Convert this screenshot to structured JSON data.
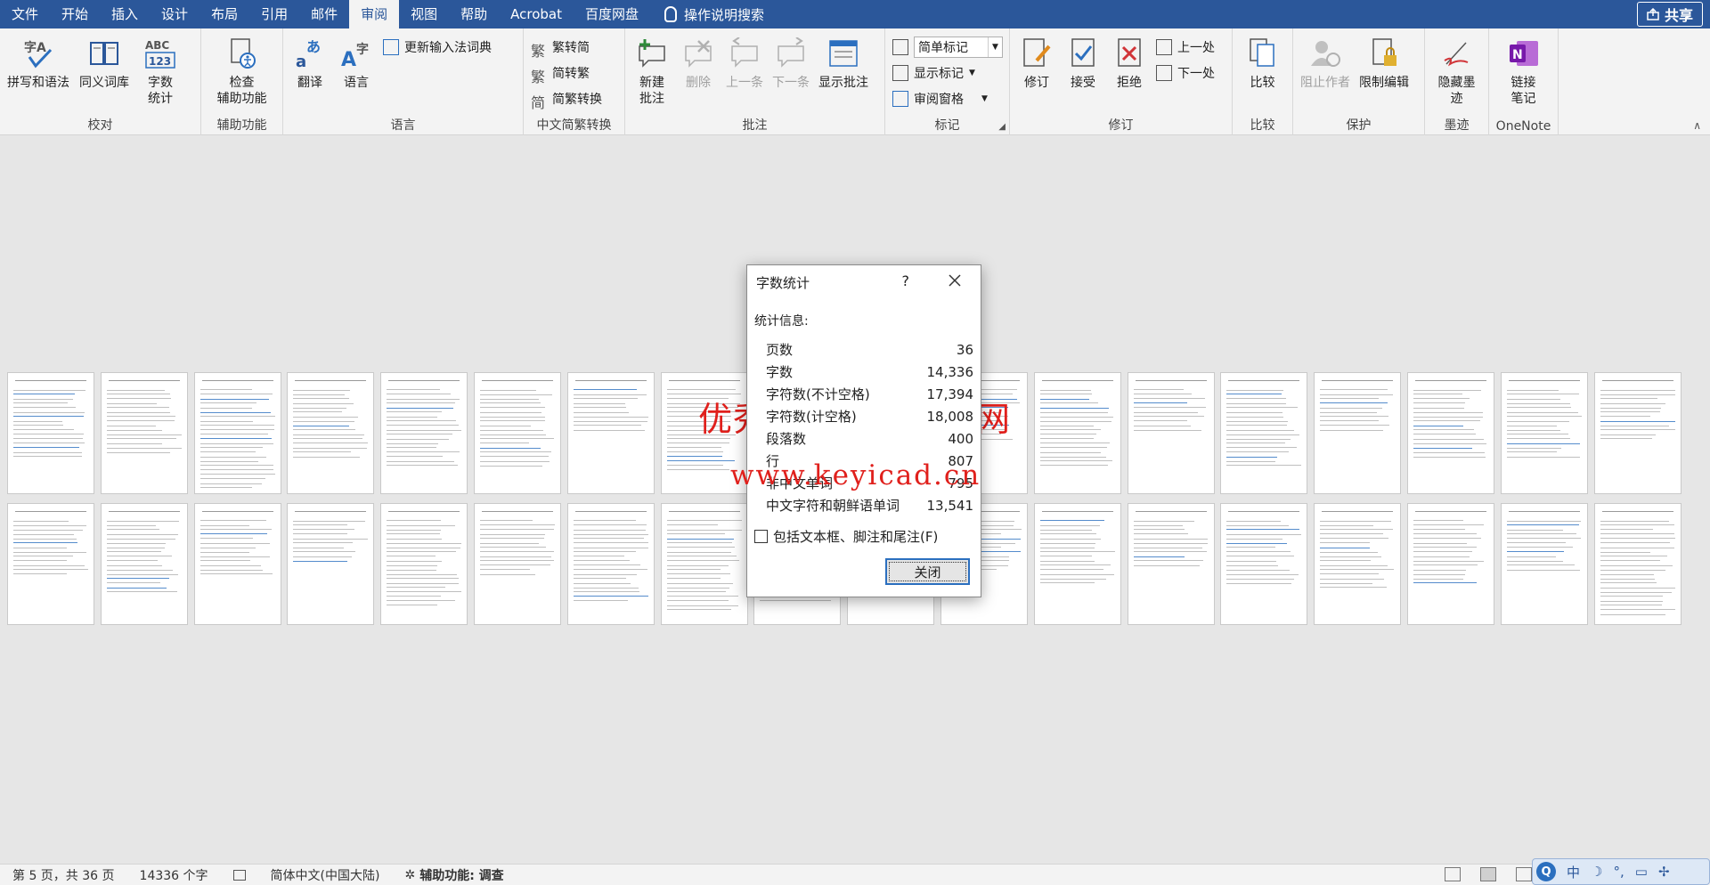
{
  "menu": {
    "tabs": [
      {
        "label": "文件",
        "active": false
      },
      {
        "label": "开始",
        "active": false
      },
      {
        "label": "插入",
        "active": false
      },
      {
        "label": "设计",
        "active": false
      },
      {
        "label": "布局",
        "active": false
      },
      {
        "label": "引用",
        "active": false
      },
      {
        "label": "邮件",
        "active": false
      },
      {
        "label": "审阅",
        "active": true
      },
      {
        "label": "视图",
        "active": false
      },
      {
        "label": "帮助",
        "active": false
      },
      {
        "label": "Acrobat",
        "active": false
      },
      {
        "label": "百度网盘",
        "active": false
      }
    ],
    "tell_me": "操作说明搜索",
    "share": "共享"
  },
  "ribbon": {
    "proofing": {
      "label": "校对",
      "spell": "拼写和语法",
      "thesaurus": "同义词库",
      "wordcount": "字数\n统计"
    },
    "accessibility": {
      "label": "辅助功能",
      "check": "检查\n辅助功能"
    },
    "language": {
      "label": "语言",
      "translate": "翻译",
      "language": "语言",
      "update_ime": "更新输入法词典"
    },
    "chinese": {
      "label": "中文简繁转换",
      "t2s": "繁转简",
      "s2t": "简转繁",
      "convert": "简繁转换"
    },
    "comments": {
      "label": "批注",
      "new": "新建\n批注",
      "delete": "删除",
      "prev": "上一条",
      "next": "下一条",
      "show": "显示批注"
    },
    "tracking": {
      "label": "标记",
      "markup_value": "简单标记",
      "show_markup": "显示标记",
      "pane": "审阅窗格"
    },
    "changes": {
      "label": "修订",
      "track": "修订",
      "accept": "接受",
      "reject": "拒绝",
      "prev": "上一处",
      "next": "下一处"
    },
    "compare": {
      "label": "比较",
      "compare": "比较"
    },
    "protect": {
      "label": "保护",
      "block": "阻止作者",
      "restrict": "限制编辑"
    },
    "ink": {
      "label": "墨迹",
      "hide": "隐藏墨\n迹"
    },
    "onenote": {
      "label": "OneNote",
      "link": "链接\n笔记"
    }
  },
  "dialog": {
    "title": "字数统计",
    "help": "?",
    "section": "统计信息:",
    "stats": [
      {
        "label": "页数",
        "value": "36"
      },
      {
        "label": "字数",
        "value": "14,336"
      },
      {
        "label": "字符数(不计空格)",
        "value": "17,394"
      },
      {
        "label": "字符数(计空格)",
        "value": "18,008"
      },
      {
        "label": "段落数",
        "value": "400"
      },
      {
        "label": "行",
        "value": "807"
      },
      {
        "label": "非中文单词",
        "value": "795"
      },
      {
        "label": "中文字符和朝鲜语单词",
        "value": "13,541"
      }
    ],
    "checkbox_label": "包括文本框、脚注和尾注(F)",
    "checkbox_checked": false,
    "close": "关闭"
  },
  "watermark": {
    "line1": "优秀毕业设计资源网",
    "line2": "www.keyicad.cn"
  },
  "status": {
    "page": "第 5 页，共 36 页",
    "words": "14336 个字",
    "lang": "简体中文(中国大陆)",
    "accessibility": "辅助功能: 调查"
  },
  "ime": {
    "lang": "中"
  },
  "colors": {
    "accent": "#2b579a",
    "watermark": "#e0201c"
  }
}
